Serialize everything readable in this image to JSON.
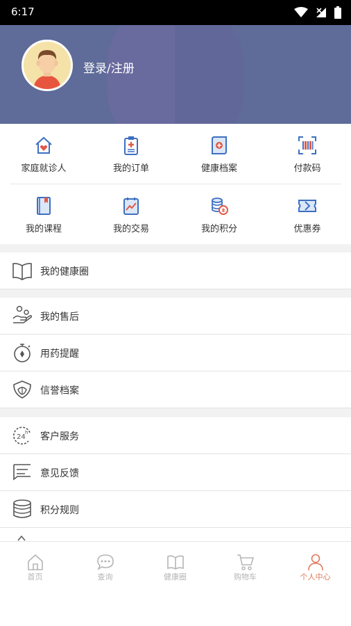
{
  "status_bar": {
    "time": "6:17"
  },
  "header": {
    "login_label": "登录/注册"
  },
  "grid_row_1": [
    {
      "label": "家庭就诊人",
      "icon": "home-heart-icon"
    },
    {
      "label": "我的订单",
      "icon": "clipboard-order-icon"
    },
    {
      "label": "健康档案",
      "icon": "health-record-icon"
    },
    {
      "label": "付款码",
      "icon": "barcode-scan-icon"
    }
  ],
  "grid_row_2": [
    {
      "label": "我的课程",
      "icon": "course-book-icon"
    },
    {
      "label": "我的交易",
      "icon": "trade-chart-icon"
    },
    {
      "label": "我的积分",
      "icon": "points-coins-icon"
    },
    {
      "label": "优惠券",
      "icon": "coupon-icon"
    }
  ],
  "list_group_1": [
    {
      "label": "我的健康圈",
      "icon": "open-book-icon"
    }
  ],
  "list_group_2": [
    {
      "label": "我的售后",
      "icon": "after-sales-icon"
    },
    {
      "label": "用药提醒",
      "icon": "stopwatch-icon"
    },
    {
      "label": "信誉档案",
      "icon": "shield-lotus-icon"
    }
  ],
  "list_group_3": [
    {
      "label": "客户服务",
      "icon": "24h-service-icon"
    },
    {
      "label": "意见反馈",
      "icon": "feedback-icon"
    },
    {
      "label": "积分规则",
      "icon": "database-icon"
    }
  ],
  "tab_bar": [
    {
      "label": "首页",
      "icon": "home-icon",
      "active": false
    },
    {
      "label": "查询",
      "icon": "chat-query-icon",
      "active": false
    },
    {
      "label": "健康圈",
      "icon": "book-icon",
      "active": false
    },
    {
      "label": "购物车",
      "icon": "cart-icon",
      "active": false
    },
    {
      "label": "个人中心",
      "icon": "person-icon",
      "active": true
    }
  ],
  "colors": {
    "header_bg": "#5f6b98",
    "accent": "#e07a5a",
    "icon_blue": "#3d6fc2",
    "icon_red": "#e05a4a"
  }
}
